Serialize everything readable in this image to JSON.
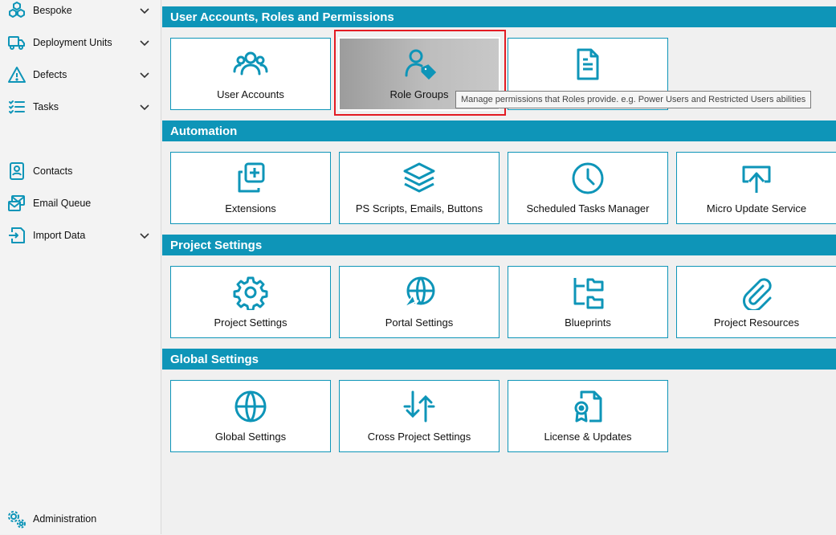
{
  "colors": {
    "accent": "#0e95b8",
    "highlight": "#e31b23",
    "icon": "#0e95b8"
  },
  "sidebar": {
    "items": [
      {
        "label": "Bespoke",
        "icon": "cubes-icon",
        "has_chevron": true
      },
      {
        "label": "Deployment Units",
        "icon": "truck-icon",
        "has_chevron": true
      },
      {
        "label": "Defects",
        "icon": "warning-icon",
        "has_chevron": true
      },
      {
        "label": "Tasks",
        "icon": "checklist-icon",
        "has_chevron": true
      },
      {
        "label": "Contacts",
        "icon": "contact-card-icon",
        "has_chevron": false
      },
      {
        "label": "Email Queue",
        "icon": "email-queue-icon",
        "has_chevron": false
      },
      {
        "label": "Import Data",
        "icon": "import-icon",
        "has_chevron": true
      }
    ],
    "footer": {
      "label": "Administration",
      "icon": "gears-icon"
    }
  },
  "sections": [
    {
      "title": "User Accounts, Roles and Permissions",
      "tiles": [
        {
          "label": "User Accounts",
          "icon": "users-icon"
        },
        {
          "label": "Role Groups",
          "icon": "user-tag-icon"
        },
        {
          "label": "",
          "icon": "document-icon"
        }
      ]
    },
    {
      "title": "Automation",
      "tiles": [
        {
          "label": "Extensions",
          "icon": "add-copy-icon"
        },
        {
          "label": "PS Scripts, Emails, Buttons",
          "icon": "layers-icon"
        },
        {
          "label": "Scheduled Tasks Manager",
          "icon": "clock-icon"
        },
        {
          "label": "Micro Update Service",
          "icon": "upload-arrow-icon"
        }
      ]
    },
    {
      "title": "Project Settings",
      "tiles": [
        {
          "label": "Project Settings",
          "icon": "gear-icon"
        },
        {
          "label": "Portal Settings",
          "icon": "globe-cursor-icon"
        },
        {
          "label": "Blueprints",
          "icon": "folder-tree-icon"
        },
        {
          "label": "Project Resources",
          "icon": "paperclip-icon"
        }
      ]
    },
    {
      "title": "Global Settings",
      "tiles": [
        {
          "label": "Global Settings",
          "icon": "globe-icon"
        },
        {
          "label": "Cross Project Settings",
          "icon": "sync-arrows-icon"
        },
        {
          "label": "License & Updates",
          "icon": "license-icon"
        }
      ]
    }
  ],
  "tooltip": {
    "text": "Manage permissions that Roles provide. e.g. Power Users and Restricted Users abilities"
  }
}
